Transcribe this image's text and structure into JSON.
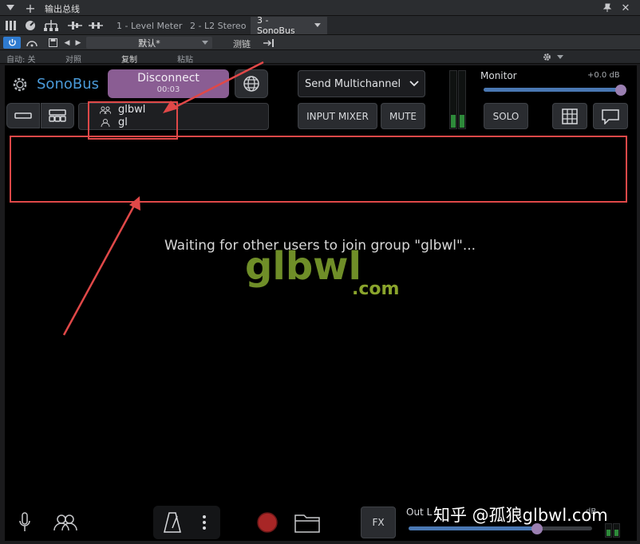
{
  "host": {
    "title": "输出总线",
    "tabs": [
      {
        "label": "1 - Level Meter"
      },
      {
        "label": "2 - L2 Stereo"
      },
      {
        "label": "3 - SonoBus"
      }
    ],
    "preset": "默认*",
    "compare_label": "测链",
    "row3": {
      "auto_off": "自动: 关",
      "pair": "对照",
      "copy": "复制",
      "paste": "粘贴"
    }
  },
  "plugin": {
    "brand": "SonoBus",
    "disconnect_label": "Disconnect",
    "elapsed": "00:03",
    "send_mode": "Send Multichannel",
    "input_mixer": "INPUT MIXER",
    "mute": "MUTE",
    "solo": "SOLO",
    "monitor_label": "Monitor",
    "monitor_value": "+0.0 dB",
    "monitor_level": 1.0,
    "group_name": "glbwl",
    "user_name": "gl",
    "waiting_text": "Waiting for other users to join group \"glbwl\"...",
    "fx_label": "FX",
    "out_label": "Out L",
    "out_value": "dB",
    "out_level": 0.78
  },
  "watermark": {
    "main": "glbwl",
    "sub": ".com",
    "credit": "知乎 @孤狼glbwl.com"
  },
  "colors": {
    "accent": "#4a9ad8",
    "disconnect_bg": "#8a5d93",
    "annotation_red": "#e04848",
    "meter_green": "#2e8a3a"
  }
}
